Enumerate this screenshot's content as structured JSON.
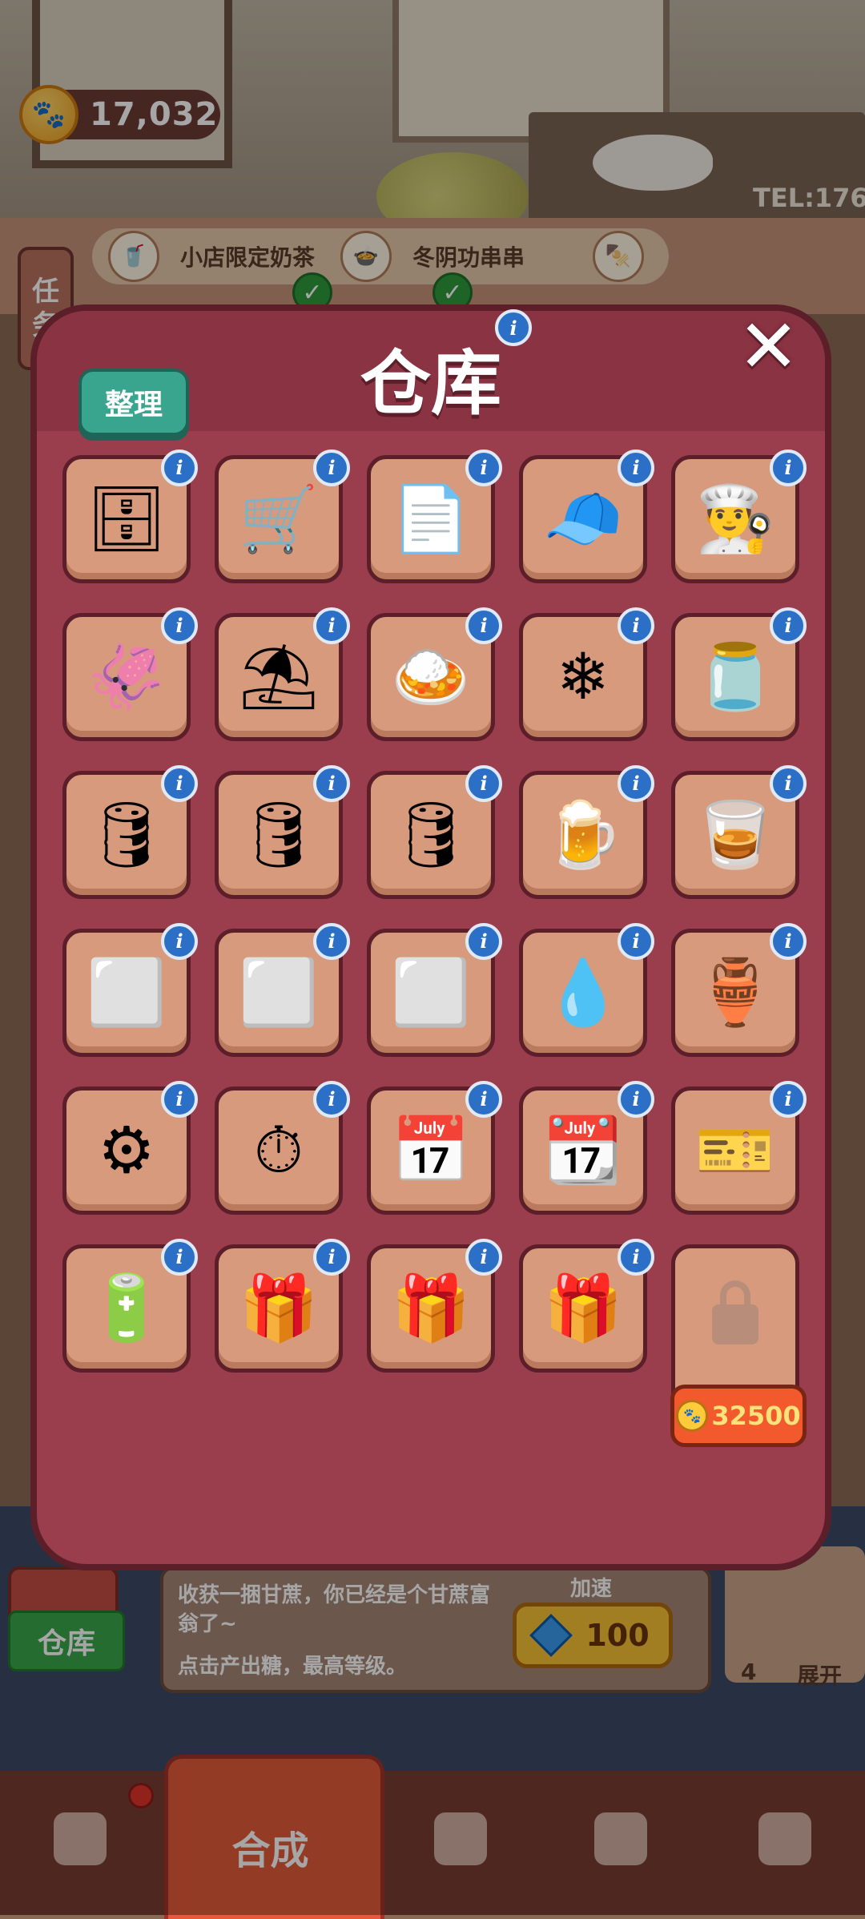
{
  "currency": {
    "amount": "17,032",
    "icon": "paw-coin-icon"
  },
  "task_button": {
    "label_line1": "任",
    "label_line2": "务"
  },
  "orders": [
    {
      "name": "小店限定奶茶",
      "icon": "milk-tea-icon",
      "completed": true
    },
    {
      "name": "冬阴功串串",
      "icon": "skewer-soup-icon",
      "completed": true
    },
    {
      "name": "",
      "icon": "skewer-icon",
      "completed": false
    }
  ],
  "background_sign": {
    "tel": "TEL:176"
  },
  "modal": {
    "title": "仓库",
    "sort_label": "整理",
    "close_label": "✕",
    "info_glyph": "i",
    "items": [
      {
        "name": "wall-shelf",
        "icon": "🗄"
      },
      {
        "name": "hand-truck",
        "icon": "🛒"
      },
      {
        "name": "paper-napkins",
        "icon": "📄"
      },
      {
        "name": "white-cap",
        "icon": "🧢"
      },
      {
        "name": "chef-hat",
        "icon": "👨‍🍳"
      },
      {
        "name": "dried-squid",
        "icon": "🦑"
      },
      {
        "name": "paper-umbrella",
        "icon": "⛱"
      },
      {
        "name": "curry-dish",
        "icon": "🍛"
      },
      {
        "name": "snowflake",
        "icon": "❄"
      },
      {
        "name": "jar",
        "icon": "🫙"
      },
      {
        "name": "wooden-barrel",
        "icon": "🛢"
      },
      {
        "name": "iron-barrel",
        "icon": "🛢"
      },
      {
        "name": "iron-barrel-2",
        "icon": "🛢"
      },
      {
        "name": "beer-glass",
        "icon": "🍺"
      },
      {
        "name": "red-glass",
        "icon": "🥃"
      },
      {
        "name": "silver-ingot",
        "icon": "⬜"
      },
      {
        "name": "silver-ingots-2",
        "icon": "⬜"
      },
      {
        "name": "silver-ingots-3",
        "icon": "⬜"
      },
      {
        "name": "silver-drop",
        "icon": "💧"
      },
      {
        "name": "golden-bottle",
        "icon": "🏺"
      },
      {
        "name": "gears",
        "icon": "⚙"
      },
      {
        "name": "stopwatch",
        "icon": "⏱"
      },
      {
        "name": "calendar-3",
        "icon": "📅"
      },
      {
        "name": "calendar-6",
        "icon": "📆"
      },
      {
        "name": "energy-ticket",
        "icon": "🎫"
      },
      {
        "name": "energy-battery",
        "icon": "🔋"
      },
      {
        "name": "purple-chest",
        "icon": "🎁"
      },
      {
        "name": "orange-chest",
        "icon": "🎁"
      },
      {
        "name": "red-chest",
        "icon": "🎁"
      }
    ],
    "locked_slot": {
      "price": "32500",
      "icon": "lock-icon"
    }
  },
  "bottom_info": {
    "message": "收获一捆甘蔗，你已经是个甘蔗富翁了~",
    "hint": "点击产出糖，最高等级。",
    "speed_label": "加速",
    "speed_cost": "100"
  },
  "warehouse_tab": {
    "label": "仓库"
  },
  "expand": {
    "count": "4",
    "label": "展开"
  },
  "nav": {
    "active_label": "合成",
    "items": [
      "bag-icon",
      "merge-icon",
      "service-bell-icon",
      "map-pin-icon",
      "bus-icon"
    ]
  },
  "colors": {
    "modal_bg": "#9a3d4d",
    "slot_bg": "#d89a7c",
    "sort_button": "#3aa58e",
    "info_badge": "#2c6fc7",
    "unlock_button": "#f2592d"
  }
}
